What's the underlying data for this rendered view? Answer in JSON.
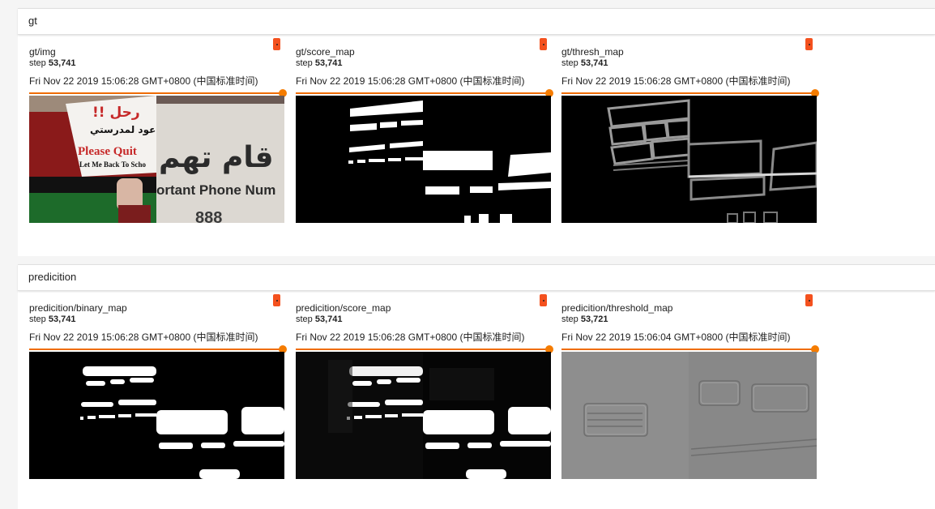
{
  "sections": [
    {
      "title": "gt",
      "cards": [
        {
          "title": "gt/img",
          "step_label": "step",
          "step_value": "53,741",
          "time": "Fri Nov 22 2019 15:06:28 GMT+0800 (中国标准时间)",
          "image": "gt-img-photo",
          "image_text": {
            "arabic_top": "!! رحل",
            "arabic_sub": "كي أعود لمدرستي",
            "please": "Please Quit",
            "letme": "Let Me Back To Scho",
            "arabic_big": "قام تهم",
            "phone": "ortant Phone Num",
            "digits": "888"
          }
        },
        {
          "title": "gt/score_map",
          "step_label": "step",
          "step_value": "53,741",
          "time": "Fri Nov 22 2019 15:06:28 GMT+0800 (中国标准时间)",
          "image": "score-map"
        },
        {
          "title": "gt/thresh_map",
          "step_label": "step",
          "step_value": "53,741",
          "time": "Fri Nov 22 2019 15:06:28 GMT+0800 (中国标准时间)",
          "image": "thresh-map"
        }
      ]
    },
    {
      "title": "predicition",
      "cards": [
        {
          "title": "predicition/binary_map",
          "step_label": "step",
          "step_value": "53,741",
          "time": "Fri Nov 22 2019 15:06:28 GMT+0800 (中国标准时间)",
          "image": "binary-map"
        },
        {
          "title": "predicition/score_map",
          "step_label": "step",
          "step_value": "53,741",
          "time": "Fri Nov 22 2019 15:06:28 GMT+0800 (中国标准时间)",
          "image": "pred-score-map"
        },
        {
          "title": "predicition/threshold_map",
          "step_label": "step",
          "step_value": "53,721",
          "time": "Fri Nov 22 2019 15:06:04 GMT+0800 (中国标准时间)",
          "image": "threshold-map"
        }
      ]
    }
  ],
  "colors": {
    "accent": "#f4511e",
    "slider": "#ef6c00"
  }
}
